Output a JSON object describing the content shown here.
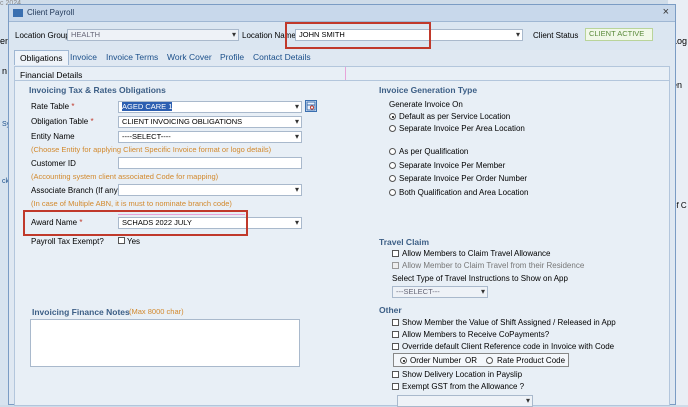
{
  "window": {
    "title": "Client Payroll",
    "close": "×"
  },
  "header": {
    "location_group_label": "Location Group",
    "location_group_value": "HEALTH",
    "location_name_label": "Location Name",
    "location_name_value": "JOHN SMITH",
    "client_status_label": "Client Status",
    "client_status_value": "CLIENT ACTIVE"
  },
  "tabs": [
    "Obligations",
    "Invoice",
    "Invoice Terms",
    "Work Cover",
    "Profile",
    "Contact Details"
  ],
  "panel": {
    "title": "Financial Details",
    "left": {
      "heading": "Invoicing Tax & Rates Obligations",
      "rate_table_label": "Rate Table",
      "rate_table_value": "AGED CARE 1",
      "obligation_table_label": "Obligation Table",
      "obligation_table_value": "CLIENT INVOICING OBLIGATIONS",
      "entity_name_label": "Entity Name",
      "entity_name_value": "----SELECT----",
      "entity_hint": "(Choose Entity for applying Client Specific Invoice format or logo details)",
      "customer_id_label": "Customer ID",
      "customer_id_value": "",
      "customer_hint": "(Accounting system client associated Code for mapping)",
      "assoc_branch_label": "Associate Branch (If any)",
      "assoc_branch_value": "",
      "branch_hint": "(In case of Multiple ABN, it is must to nominate branch code)",
      "award_name_label": "Award Name",
      "award_name_value": "SCHADS 2022 JULY",
      "payroll_tax_label": "Payroll Tax Exempt?",
      "payroll_tax_yes": "Yes",
      "required_mark": "*",
      "notes_heading": "Invoicing Finance Notes",
      "notes_hint": "(Max 8000 char)"
    },
    "right": {
      "heading": "Invoice Generation Type",
      "generate_label": "Generate Invoice On",
      "options": [
        "Default as per Service Location",
        "Separate Invoice Per Area Location",
        "As per Qualification",
        "Separate Invoice Per Member",
        "Separate Invoice Per Order Number",
        "Both Qualification and Area Location"
      ],
      "travel_heading": "Travel Claim",
      "travel_allow": "Allow Members to Claim Travel Allowance",
      "travel_residence": "Allow Member to Claim Travel from their Residence",
      "travel_type_label": "Select Type of Travel Instructions to Show on App",
      "travel_type_value": "---SELECT---",
      "other_heading": "Other",
      "other_opts": [
        "Show Member the Value of Shift Assigned / Released in App",
        "Allow Members to Receive CoPayments?",
        "Override default Client Reference code in Invoice with Code"
      ],
      "order_number": "Order Number",
      "or_text": "OR",
      "rate_product_code": "Rate Product Code",
      "other_opts2": [
        "Show Delivery Location in Payslip",
        "Exempt GST from the Allowance ?"
      ]
    }
  },
  "background": {
    "left_fragments": [
      "c 2024",
      "en",
      "n",
      "Sy",
      "ck"
    ],
    "right_fragments": [
      "Log",
      "en",
      "of C"
    ]
  },
  "colors": {
    "accent": "#1b4f8a",
    "hint": "#d2892d",
    "highlight": "#c0392b",
    "selection": "#2c5fb1"
  }
}
